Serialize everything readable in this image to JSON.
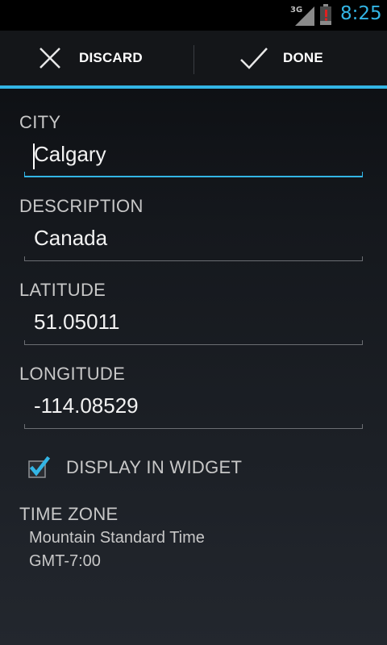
{
  "status_bar": {
    "network": "3G",
    "time": "8:25"
  },
  "action_bar": {
    "discard_label": "DISCARD",
    "done_label": "DONE"
  },
  "form": {
    "city": {
      "label": "CITY",
      "value": "Calgary"
    },
    "description": {
      "label": "DESCRIPTION",
      "value": "Canada"
    },
    "latitude": {
      "label": "LATITUDE",
      "value": "51.05011"
    },
    "longitude": {
      "label": "LONGITUDE",
      "value": "-114.08529"
    },
    "display_in_widget": {
      "label": "DISPLAY IN WIDGET",
      "checked": true
    },
    "time_zone": {
      "label": "TIME ZONE",
      "name": "Mountain Standard Time",
      "offset": "GMT-7:00"
    }
  },
  "icons": {
    "discard": "close-icon",
    "done": "check-icon",
    "signal": "signal-icon",
    "battery": "battery-icon"
  },
  "colors": {
    "accent": "#33b5e5",
    "battery_alert": "#e02020"
  }
}
